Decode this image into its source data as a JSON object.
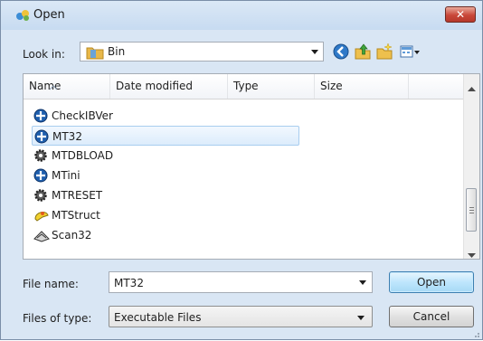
{
  "window": {
    "title": "Open",
    "close_label": "✕"
  },
  "lookin": {
    "label": "Look in:",
    "value": "Bin"
  },
  "toolbar": {
    "icons": [
      "back-icon",
      "up-folder-icon",
      "new-folder-icon",
      "views-menu-icon"
    ]
  },
  "list": {
    "columns": [
      "Name",
      "Date modified",
      "Type",
      "Size"
    ],
    "items": [
      {
        "name": "CheckIBVer",
        "icon": "globe-app-icon"
      },
      {
        "name": "MT32",
        "icon": "globe-app-icon",
        "selected": true
      },
      {
        "name": "MTDBLOAD",
        "icon": "gear-app-icon"
      },
      {
        "name": "MTini",
        "icon": "globe-app-icon"
      },
      {
        "name": "MTRESET",
        "icon": "gear-app-icon"
      },
      {
        "name": "MTStruct",
        "icon": "yellow-app-icon"
      },
      {
        "name": "Scan32",
        "icon": "scanner-icon"
      }
    ]
  },
  "filename": {
    "label": "File name:",
    "value": "MT32"
  },
  "filetype": {
    "label": "Files of type:",
    "value": "Executable Files"
  },
  "buttons": {
    "open": "Open",
    "cancel": "Cancel"
  },
  "colors": {
    "dialog_bg": "#d9e6f4",
    "selection": "#dcecfc",
    "close_red": "#c9473a"
  }
}
